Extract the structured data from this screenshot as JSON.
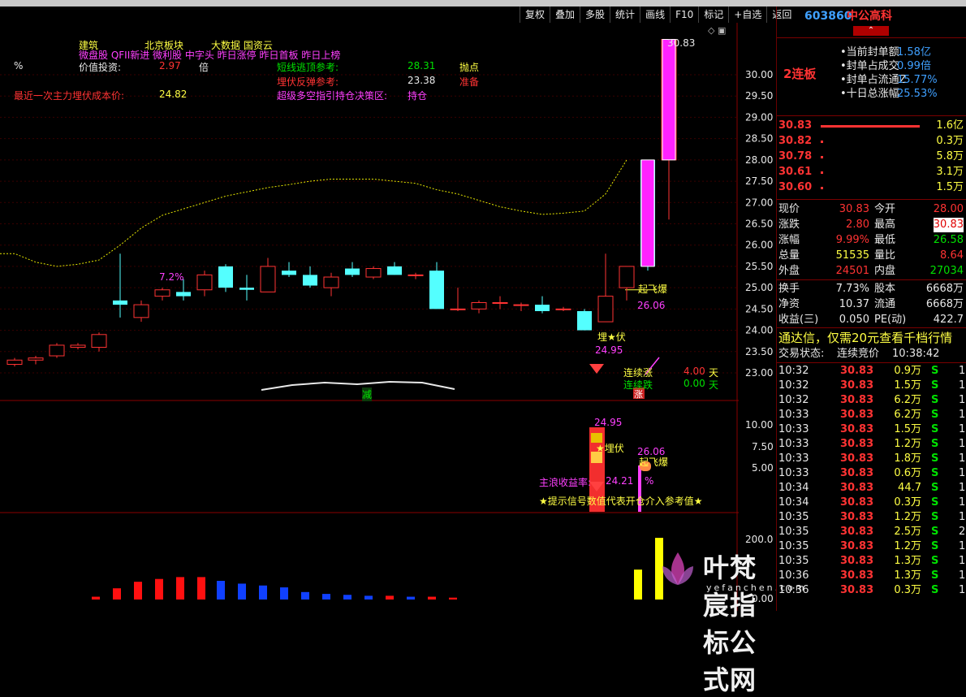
{
  "toolbar": [
    "复权",
    "叠加",
    "多股",
    "统计",
    "画线",
    "F10",
    "标记",
    "+自选",
    "返回"
  ],
  "stock": {
    "code": "603860",
    "name": "中公高科"
  },
  "header_lines": {
    "tags1": [
      "建筑",
      "北京板块",
      "大数据 国资云"
    ],
    "tags2": "微盘股 QFII新进 微利股 中字头 昨日涨停 昨日首板 昨日上榜",
    "pct_label": "%",
    "value_label": "价值投资:",
    "value_num": "2.97",
    "value_unit": "倍",
    "cost_label": "最近一次主力埋伏成本价:",
    "cost_value": "24.82",
    "short_label": "短线逃顶参考:",
    "short_value": "28.31",
    "short_action": "抛点",
    "rebound_label": "埋伏反弹参考:",
    "rebound_value": "23.38",
    "rebound_action": "准备",
    "super_label": "超级多空指引持仓决策区:",
    "super_action": "持仓"
  },
  "price_axis": [
    "30.00",
    "29.50",
    "29.00",
    "28.50",
    "28.00",
    "27.50",
    "27.00",
    "26.50",
    "26.00",
    "25.50",
    "25.00",
    "24.50",
    "24.00",
    "23.50",
    "23.00"
  ],
  "high_label": "30.83",
  "annotations": {
    "qifei": "起飞爆",
    "qifei_val": "26.06",
    "maifu": "埋★伏",
    "maifu_val": "24.95",
    "lianxu_zhang": "连续涨",
    "lianxu_die": "连续跌",
    "zhang_days": "4.00",
    "die_days": "0.00",
    "tian": "天",
    "jian": "减",
    "zhang": "涨"
  },
  "sub1": {
    "axis": [
      "10.00",
      "7.50",
      "5.00"
    ],
    "v1": "24.95",
    "maifu": "★埋伏",
    "v2": "26.06",
    "qifei": "起飞爆",
    "main_label": "主浪收益率:",
    "main_val": "24.21",
    "pct": "%",
    "hint": "★提示信号数值代表开仓介入参考值★"
  },
  "sub2": {
    "axis": [
      "200.0",
      "0.00"
    ]
  },
  "chart_data": {
    "type": "candlestick",
    "ohlc": [
      [
        23.2,
        23.35,
        23.15,
        23.3
      ],
      [
        23.3,
        23.4,
        23.2,
        23.35
      ],
      [
        23.4,
        23.7,
        23.35,
        23.65
      ],
      [
        23.6,
        23.7,
        23.55,
        23.65
      ],
      [
        23.6,
        23.95,
        23.5,
        23.9
      ],
      [
        24.7,
        25.8,
        24.3,
        24.6
      ],
      [
        24.3,
        24.7,
        24.2,
        24.6
      ],
      [
        24.8,
        25.0,
        24.7,
        24.95
      ],
      [
        24.9,
        25.2,
        24.7,
        24.8
      ],
      [
        24.95,
        25.4,
        24.8,
        25.3
      ],
      [
        25.5,
        25.55,
        24.9,
        25.0
      ],
      [
        25.0,
        25.3,
        24.7,
        24.95
      ],
      [
        24.9,
        25.7,
        24.9,
        25.5
      ],
      [
        25.4,
        25.6,
        25.25,
        25.3
      ],
      [
        25.3,
        25.5,
        25.0,
        25.05
      ],
      [
        25.0,
        25.35,
        24.8,
        25.25
      ],
      [
        25.45,
        25.6,
        25.25,
        25.3
      ],
      [
        25.25,
        25.5,
        25.2,
        25.45
      ],
      [
        25.5,
        25.6,
        25.3,
        25.3
      ],
      [
        25.3,
        25.35,
        25.2,
        25.3
      ],
      [
        25.4,
        25.6,
        24.5,
        24.5
      ],
      [
        24.5,
        25.0,
        24.45,
        24.5
      ],
      [
        24.5,
        24.7,
        24.4,
        24.65
      ],
      [
        24.65,
        24.8,
        24.5,
        24.65
      ],
      [
        24.6,
        24.65,
        24.45,
        24.6
      ],
      [
        24.6,
        24.8,
        24.4,
        24.45
      ],
      [
        24.5,
        24.55,
        24.45,
        24.5
      ],
      [
        24.45,
        24.5,
        24.0,
        24.0
      ],
      [
        24.2,
        25.8,
        24.2,
        24.8
      ],
      [
        25.0,
        25.5,
        24.7,
        25.5
      ],
      [
        28.0,
        28.0,
        25.4,
        25.5
      ],
      [
        28.0,
        30.83,
        26.6,
        30.83
      ]
    ],
    "ma_line": [
      25.8,
      25.6,
      25.5,
      25.55,
      25.65,
      26.0,
      26.4,
      26.7,
      26.85,
      27.0,
      27.15,
      27.25,
      27.35,
      27.42,
      27.5,
      27.55,
      27.55,
      27.55,
      27.5,
      27.45,
      27.3,
      27.2,
      27.05,
      26.9,
      26.8,
      26.72,
      26.75,
      26.8,
      27.2,
      28.0
    ],
    "volume_bars": [
      {
        "v": 15,
        "c": "red"
      },
      {
        "v": 60,
        "c": "red"
      },
      {
        "v": 95,
        "c": "red"
      },
      {
        "v": 110,
        "c": "red"
      },
      {
        "v": 120,
        "c": "red"
      },
      {
        "v": 120,
        "c": "red"
      },
      {
        "v": 100,
        "c": "blue"
      },
      {
        "v": 85,
        "c": "blue"
      },
      {
        "v": 75,
        "c": "blue"
      },
      {
        "v": 65,
        "c": "blue"
      },
      {
        "v": 40,
        "c": "blue"
      },
      {
        "v": 30,
        "c": "blue"
      },
      {
        "v": 25,
        "c": "blue"
      },
      {
        "v": 20,
        "c": "blue"
      },
      {
        "v": 20,
        "c": "red"
      },
      {
        "v": 15,
        "c": "blue"
      },
      {
        "v": 15,
        "c": "red"
      },
      {
        "v": 10,
        "c": "red"
      },
      {
        "v": 160,
        "c": "yellow"
      },
      {
        "v": 330,
        "c": "yellow"
      }
    ]
  },
  "side": {
    "lianban": "2连板",
    "seal_info": [
      {
        "label": "当前封单额",
        "value": "1.58亿"
      },
      {
        "label": "封单占成交",
        "value": "0.99倍"
      },
      {
        "label": "封单占流通Z",
        "value": "15.77%"
      },
      {
        "label": "十日总涨幅",
        "value": "25.53%"
      }
    ],
    "bids": [
      {
        "price": "30.83",
        "vol": "1.6亿",
        "bar": 90
      },
      {
        "price": "30.82",
        "vol": "0.3万",
        "bar": 2
      },
      {
        "price": "30.78",
        "vol": "5.8万",
        "bar": 2
      },
      {
        "price": "30.61",
        "vol": "3.1万",
        "bar": 2
      },
      {
        "price": "30.60",
        "vol": "1.5万",
        "bar": 2
      }
    ],
    "quotes": [
      [
        "现价",
        "30.83",
        "今开",
        "28.00"
      ],
      [
        "涨跌",
        "2.80",
        "最高",
        "30.83"
      ],
      [
        "涨幅",
        "9.99%",
        "最低",
        "26.58"
      ],
      [
        "总量",
        "51535",
        "量比",
        "8.64"
      ],
      [
        "外盘",
        "24501",
        "内盘",
        "27034"
      ]
    ],
    "quotes2": [
      [
        "换手",
        "7.73%",
        "股本",
        "6668万"
      ],
      [
        "净资",
        "10.37",
        "流通",
        "6668万"
      ],
      [
        "收益(三)",
        "0.050",
        "PE(动)",
        "422.7"
      ]
    ],
    "ad": "通达信，仅需20元查看千档行情",
    "trade_status_label": "交易状态:",
    "trade_status": "连续竞价",
    "trade_time": "10:38:42",
    "ticks": [
      [
        "10:32",
        "30.83",
        "0.9万",
        "S",
        "1"
      ],
      [
        "10:32",
        "30.83",
        "1.5万",
        "S",
        "1"
      ],
      [
        "10:32",
        "30.83",
        "6.2万",
        "S",
        "1"
      ],
      [
        "10:33",
        "30.83",
        "6.2万",
        "S",
        "1"
      ],
      [
        "10:33",
        "30.83",
        "1.5万",
        "S",
        "1"
      ],
      [
        "10:33",
        "30.83",
        "1.2万",
        "S",
        "1"
      ],
      [
        "10:33",
        "30.83",
        "1.8万",
        "S",
        "1"
      ],
      [
        "10:33",
        "30.83",
        "0.6万",
        "S",
        "1"
      ],
      [
        "10:34",
        "30.83",
        "44.7万",
        "S",
        "1"
      ],
      [
        "10:34",
        "30.83",
        "0.3万",
        "S",
        "1"
      ],
      [
        "10:35",
        "30.83",
        "1.2万",
        "S",
        "1"
      ],
      [
        "10:35",
        "30.83",
        "2.5万",
        "S",
        "2"
      ],
      [
        "10:35",
        "30.83",
        "1.2万",
        "S",
        "1"
      ],
      [
        "10:35",
        "30.83",
        "1.3万",
        "S",
        "1"
      ],
      [
        "10:36",
        "30.83",
        "1.3万",
        "S",
        "1"
      ],
      [
        "10:36",
        "30.83",
        "0.3万",
        "S",
        "1"
      ]
    ]
  },
  "watermark": {
    "title": "叶梵宸指标公式网",
    "url": "yefanchen.com"
  }
}
